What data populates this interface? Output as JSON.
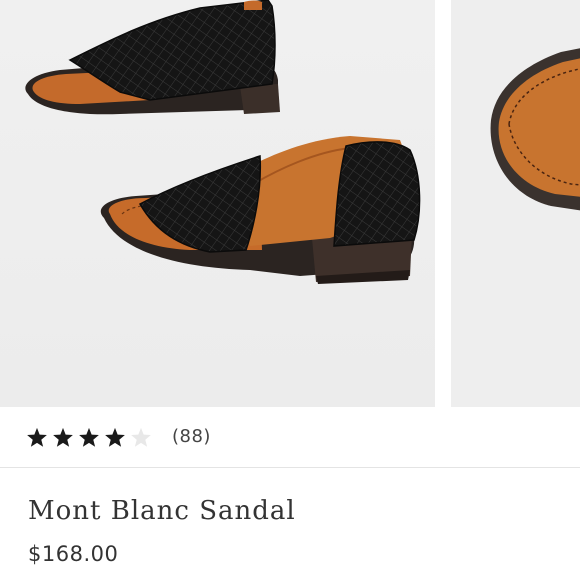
{
  "gallery": {
    "images": [
      {
        "icon": "sandal-pair-photo"
      },
      {
        "icon": "sandal-closeup-photo"
      }
    ]
  },
  "rating": {
    "value": 4,
    "max": 5,
    "count_label": "(88)"
  },
  "product": {
    "name": "Mont Blanc Sandal",
    "price": "$168.00"
  },
  "colors": {
    "star_filled": "#1a1a1a",
    "star_empty": "#e8e8e8",
    "text": "#333333",
    "divider": "#e4e4e4"
  }
}
